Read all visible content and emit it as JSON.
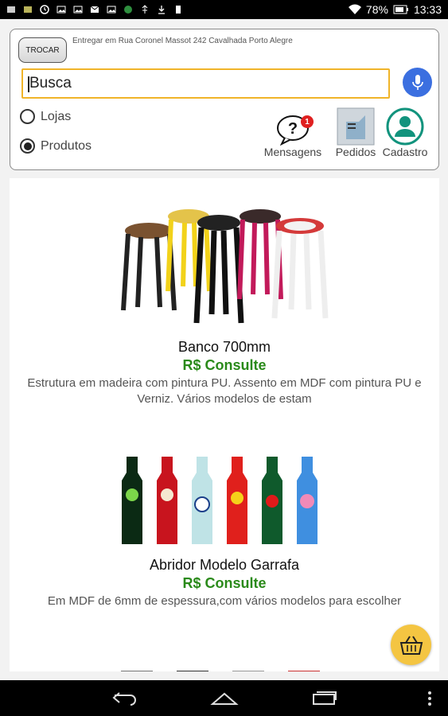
{
  "status_bar": {
    "left_icons": [
      "gallery-icon",
      "photo-icon",
      "clock-icon",
      "image-icon",
      "image-icon",
      "gmail-icon",
      "image-icon",
      "app-icon",
      "usb-icon",
      "download-icon",
      "battery-icon"
    ],
    "battery_percent": "78%",
    "time": "13:33"
  },
  "header": {
    "trocar_label": "TROCAR",
    "address": "Entregar em Rua Coronel Massot 242  Cavalhada Porto Alegre",
    "search_value": "Busca",
    "mode_options": [
      {
        "label": "Lojas",
        "selected": false
      },
      {
        "label": "Produtos",
        "selected": true
      }
    ],
    "nav": {
      "mensagens": {
        "label": "Mensagens",
        "badge": "1"
      },
      "pedidos": {
        "label": "Pedidos"
      },
      "cadastro": {
        "label": "Cadastro"
      }
    },
    "colors": {
      "search_border": "#f0b429",
      "mic": "#3b6fe0",
      "cadastro": "#12937d"
    }
  },
  "products": [
    {
      "name": "Banco 700mm",
      "price": "R$ Consulte",
      "description": "Estrutura em madeira com pintura PU. Assento em MDF com pintura PU e Verniz. Vários modelos de estam"
    },
    {
      "name": "Abridor Modelo Garrafa",
      "price": "R$ Consulte",
      "description": "Em MDF de 6mm de espessura,com vários modelos para escolher"
    }
  ],
  "colors": {
    "price": "#2a8a1a",
    "cart_fab": "#f4c542"
  }
}
